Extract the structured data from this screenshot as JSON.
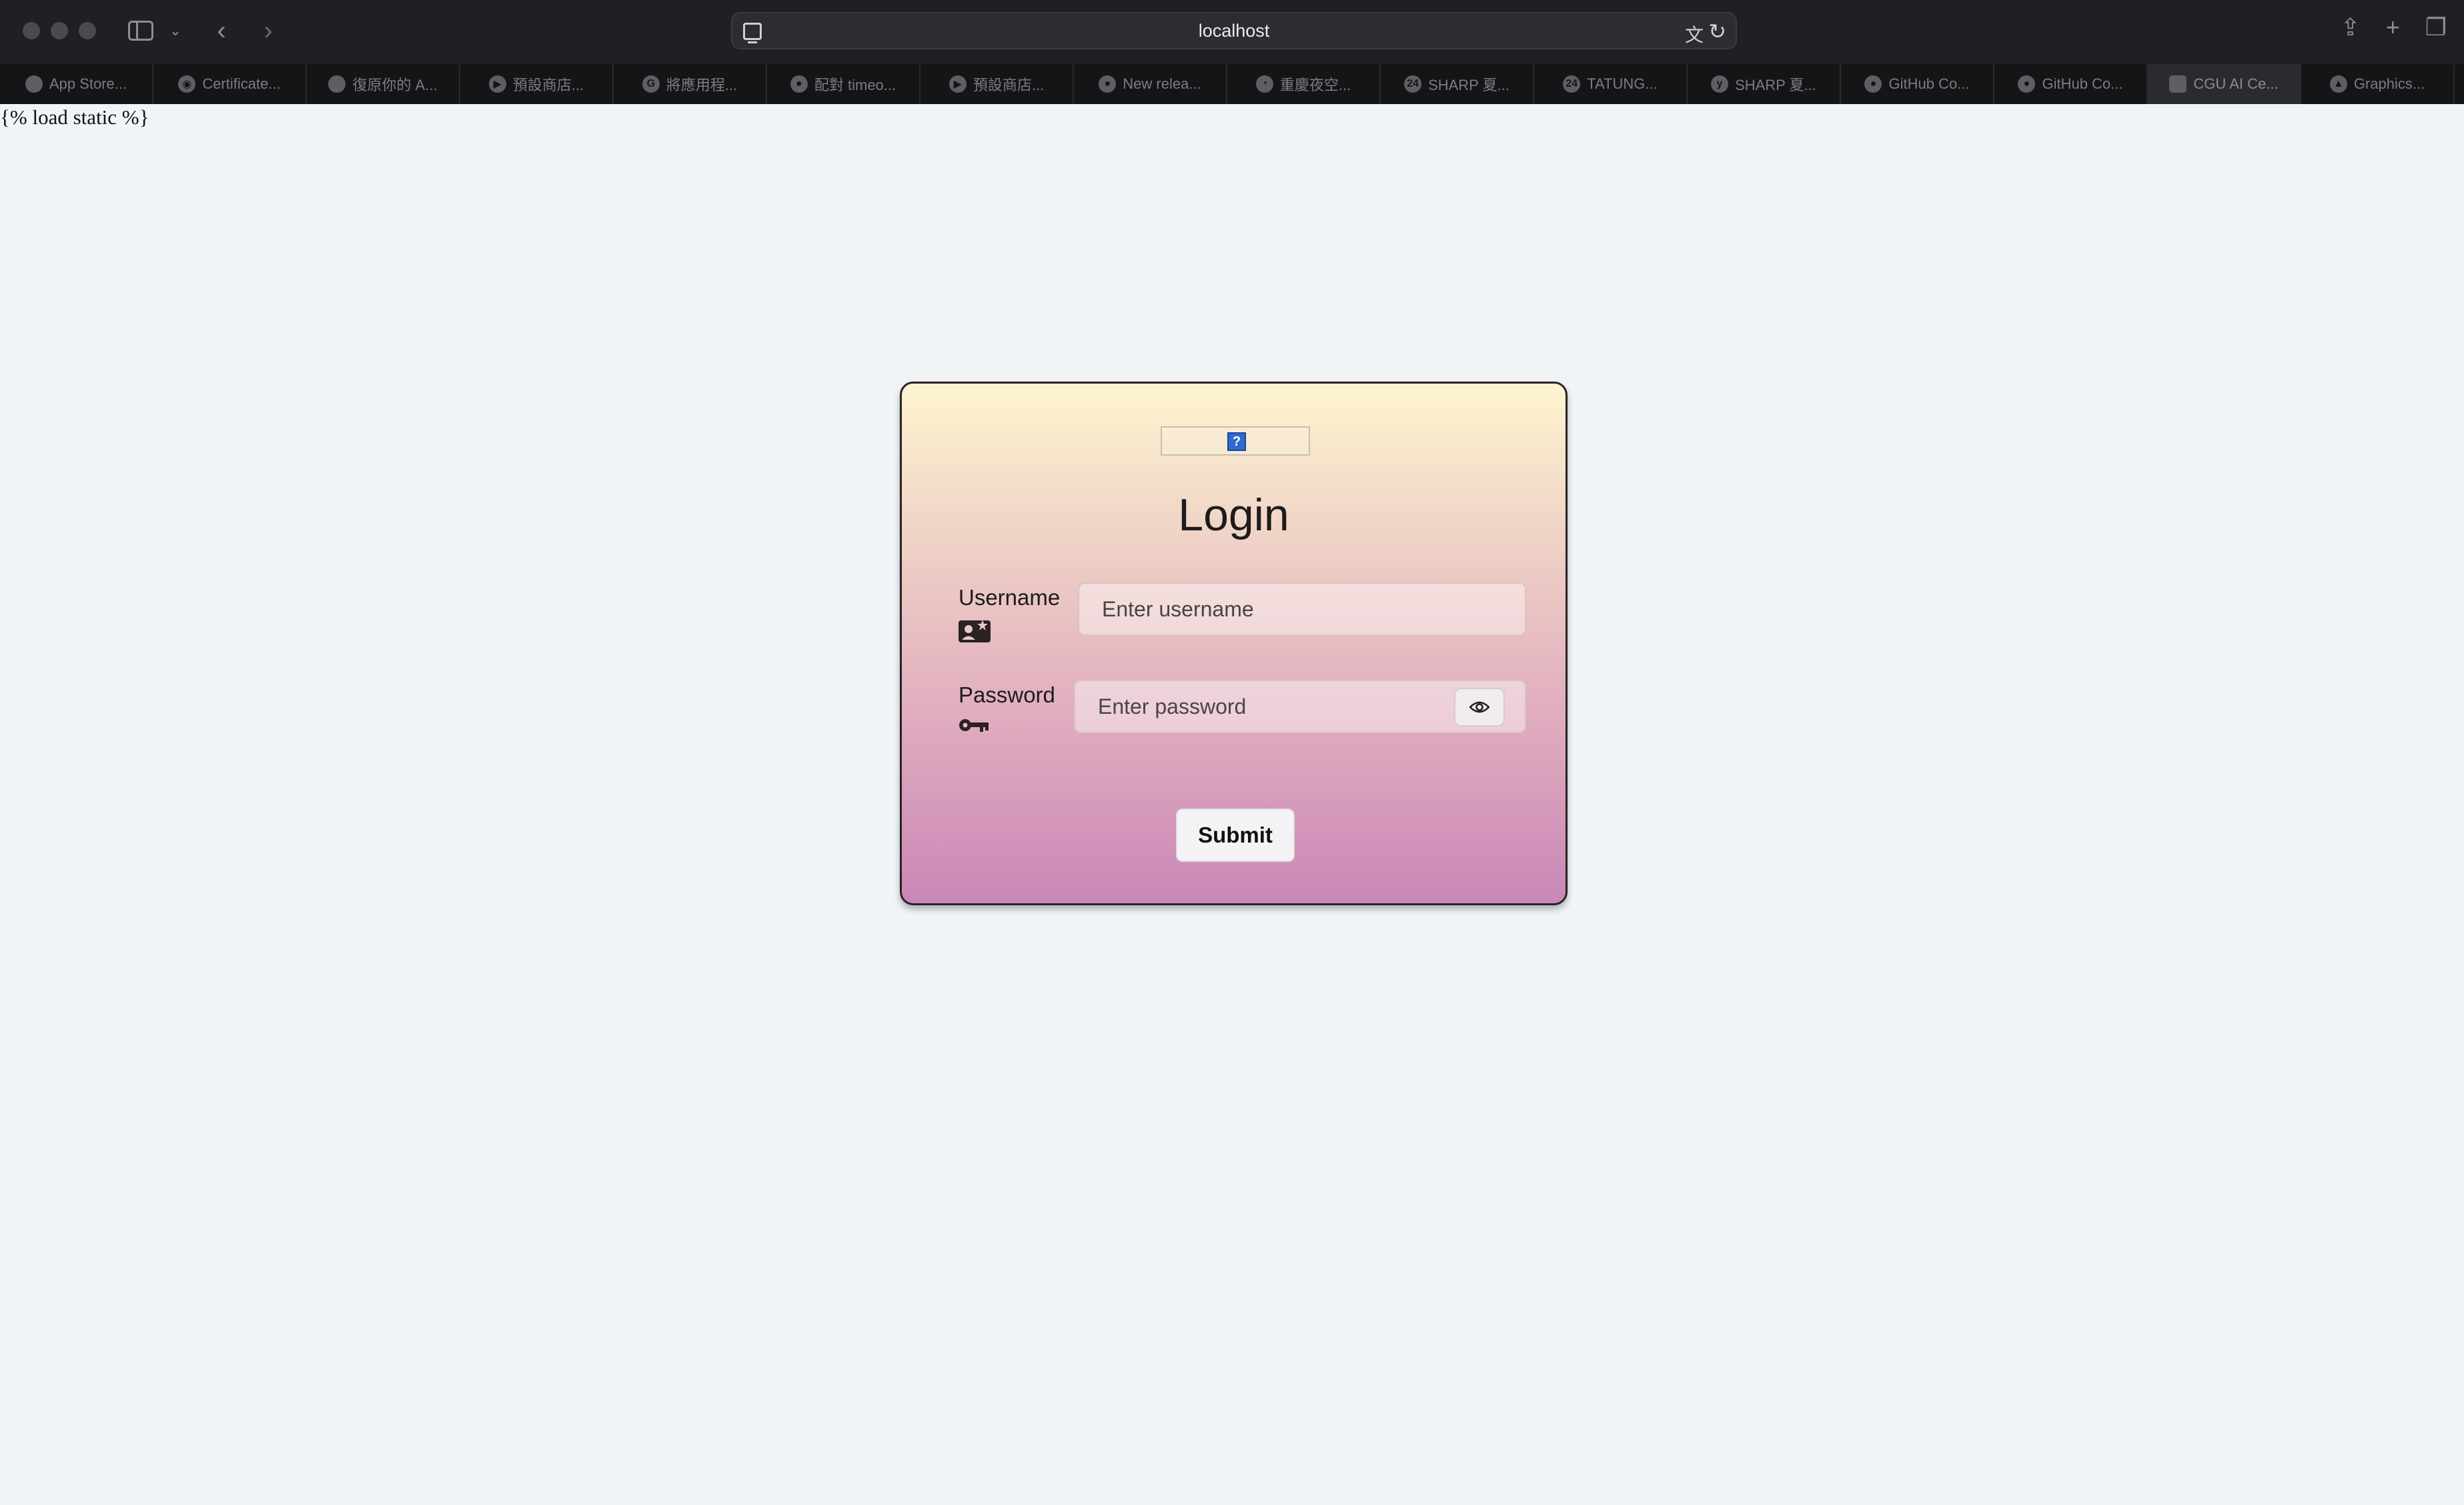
{
  "browser": {
    "url": "localhost",
    "tabs": [
      {
        "label": "App Store...",
        "icon": "apple-icon"
      },
      {
        "label": "Certificate...",
        "icon": "certificate-icon"
      },
      {
        "label": "復原你的 A...",
        "icon": "apple-icon"
      },
      {
        "label": "預設商店...",
        "icon": "play-icon"
      },
      {
        "label": "將應用程...",
        "icon": "google-icon"
      },
      {
        "label": "配對 timeo...",
        "icon": "github-icon"
      },
      {
        "label": "預設商店...",
        "icon": "play-icon"
      },
      {
        "label": "New relea...",
        "icon": "github-icon"
      },
      {
        "label": "重慶夜空...",
        "icon": "clock-icon"
      },
      {
        "label": "SHARP 夏...",
        "icon": "24-icon"
      },
      {
        "label": "TATUNG...",
        "icon": "24-icon"
      },
      {
        "label": "SHARP 夏...",
        "icon": "yahoo-icon"
      },
      {
        "label": "GitHub Co...",
        "icon": "github-icon"
      },
      {
        "label": "GitHub Co...",
        "icon": "github-icon"
      },
      {
        "label": "CGU AI Ce...",
        "icon": "square-icon"
      },
      {
        "label": "Graphics...",
        "icon": "drive-icon"
      }
    ],
    "active_tab_index": 14
  },
  "page": {
    "template_text": "{% load static %}",
    "login": {
      "title": "Login",
      "username_label": "Username",
      "username_placeholder": "Enter username",
      "password_label": "Password",
      "password_placeholder": "Enter password",
      "submit_label": "Submit"
    }
  }
}
